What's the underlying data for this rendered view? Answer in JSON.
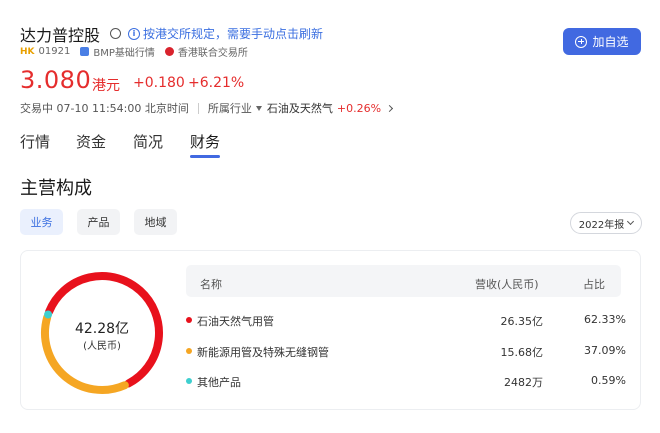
{
  "header": {
    "stock_name": "达力普控股",
    "refresh_notice": "按港交所规定，需要手动点击刷新",
    "market_tag": "HK",
    "code": "01921",
    "quote_source": "BMP基础行情",
    "exchange": "香港联合交易所",
    "add_button_label": "加自选"
  },
  "quote": {
    "price": "3.080",
    "currency": "港元",
    "change": "+0.180",
    "change_pct": "+6.21%",
    "status": "交易中 07-10 11:54:00 北京时间",
    "industry_label": "所属行业",
    "industry": "石油及天然气",
    "industry_pct": "+0.26%"
  },
  "tabs": [
    {
      "label": "行情",
      "active": false
    },
    {
      "label": "资金",
      "active": false
    },
    {
      "label": "简况",
      "active": false
    },
    {
      "label": "财务",
      "active": true
    }
  ],
  "section_title": "主营构成",
  "filters": [
    {
      "label": "业务",
      "active": true
    },
    {
      "label": "产品",
      "active": false
    },
    {
      "label": "地域",
      "active": false
    }
  ],
  "year_select": "2022年报",
  "donut": {
    "total": "42.28亿",
    "unit": "(人民币)"
  },
  "table": {
    "headers": [
      "名称",
      "营收(人民币)",
      "占比"
    ],
    "rows": [
      {
        "name": "石油天然气用管",
        "revenue": "26.35亿",
        "pct": "62.33%",
        "color": "#e8111c"
      },
      {
        "name": "新能源用管及特殊无缝钢管",
        "revenue": "15.68亿",
        "pct": "37.09%",
        "color": "#f5a623"
      },
      {
        "name": "其他产品",
        "revenue": "2482万",
        "pct": "0.59%",
        "color": "#3ecfcf"
      }
    ]
  },
  "chart_data": {
    "type": "pie",
    "categories": [
      "石油天然气用管",
      "新能源用管及特殊无缝钢管",
      "其他产品"
    ],
    "values": [
      62.33,
      37.09,
      0.59
    ],
    "colors": [
      "#e8111c",
      "#f5a623",
      "#3ecfcf"
    ]
  },
  "colors": {
    "accent": "#4169e1",
    "up": "#e52d2d"
  }
}
